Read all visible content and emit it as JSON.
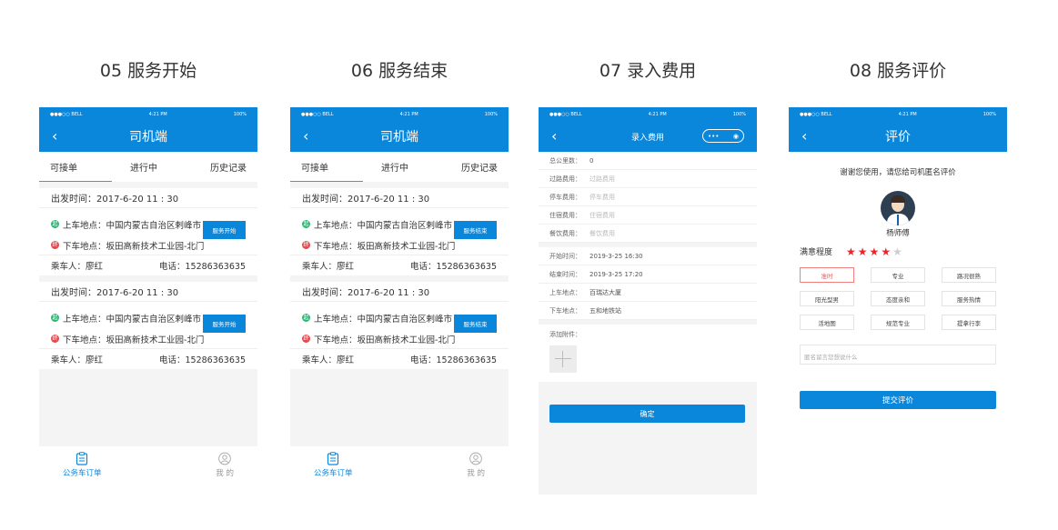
{
  "step_titles": [
    "05 服务开始",
    "06 服务结束",
    "07 录入费用",
    "08 服务评价"
  ],
  "status_bar": {
    "carrier": "●●●○○ BELL",
    "time": "4:21 PM",
    "battery": "100%"
  },
  "driver_app": {
    "title": "司机端",
    "tabs": [
      "可接单",
      "进行中",
      "历史记录"
    ],
    "tabbar": {
      "orders": "公务车订单",
      "mine": "我 的"
    }
  },
  "orders": [
    {
      "depart": "出发时间：2017-6-20     11 : 30",
      "pickup": "上车地点：中国内蒙古自治区剌峰市",
      "dropoff": "下车地点：坂田高新技术工业园-北门",
      "passenger": "乘车人：廖红",
      "phone": "电话：15286363635"
    },
    {
      "depart": "出发时间：2017-6-20     11 : 30",
      "pickup": "上车地点：中国内蒙古自治区剌峰市",
      "dropoff": "下车地点：坂田高新技术工业园-北门",
      "passenger": "乘车人：廖红",
      "phone": "电话：15286363635"
    }
  ],
  "dots": {
    "pickup": "起",
    "dropoff": "终"
  },
  "buttons": {
    "start": "服务开始",
    "end": "服务结束"
  },
  "fee": {
    "title": "录入费用",
    "capsule": "•••",
    "rows": [
      {
        "label": "总公里数：",
        "value": "0"
      },
      {
        "label": "过路费用：",
        "placeholder": "过路费用"
      },
      {
        "label": "停车费用：",
        "placeholder": "停车费用"
      },
      {
        "label": "住宿费用：",
        "placeholder": "住宿费用"
      },
      {
        "label": "餐饮费用：",
        "placeholder": "餐饮费用"
      }
    ],
    "rows2": [
      {
        "label": "开始时间：",
        "value": "2019-3-25    16:30"
      },
      {
        "label": "结束时间：",
        "value": "2019-3-25    17:20"
      },
      {
        "label": "上车地点：",
        "value": "百瑞达大厦"
      },
      {
        "label": "下车地点：",
        "value": "五和地铁站"
      }
    ],
    "attach_label": "添加附件：",
    "confirm": "确定"
  },
  "review": {
    "title": "评价",
    "thanks": "谢谢您使用，请您给司机匿名评价",
    "driver": "杨师傅",
    "satisfaction_label": "满意程度",
    "rating": 4,
    "rating_max": 5,
    "tags": [
      "准时",
      "专业",
      "路况很熟",
      "阳光型男",
      "态度亲和",
      "服务热情",
      "活地图",
      "规范专业",
      "提拿行李"
    ],
    "selected_tag": "准时",
    "comment_placeholder": "匿名留言您想说什么",
    "submit": "提交评价"
  },
  "colors": {
    "primary": "#0a86da",
    "green": "#2bb673",
    "red": "#e8464b",
    "star": "#e8262c"
  }
}
